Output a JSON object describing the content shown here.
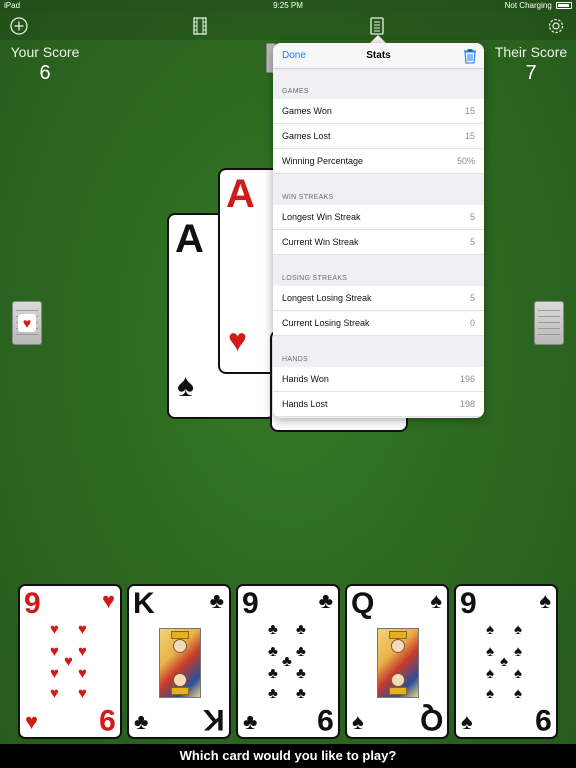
{
  "status_bar": {
    "device": "iPad",
    "time": "9:25 PM",
    "charging": "Not Charging"
  },
  "scores": {
    "you_label": "Your Score",
    "you_value": "6",
    "them_label": "Their Score",
    "them_value": "7"
  },
  "played_cards": [
    {
      "rank": "A",
      "suit": "♠",
      "color": "#111111"
    },
    {
      "rank": "A",
      "suit": "♥",
      "color": "#d21a1a"
    }
  ],
  "stats_popover": {
    "done_label": "Done",
    "title": "Stats",
    "sections": [
      {
        "header": "GAMES",
        "rows": [
          {
            "label": "Games Won",
            "value": "15"
          },
          {
            "label": "Games Lost",
            "value": "15"
          },
          {
            "label": "Winning Percentage",
            "value": "50%"
          }
        ]
      },
      {
        "header": "WIN STREAKS",
        "rows": [
          {
            "label": "Longest Win Streak",
            "value": "5"
          },
          {
            "label": "Current Win Streak",
            "value": "5"
          }
        ]
      },
      {
        "header": "LOSING STREAKS",
        "rows": [
          {
            "label": "Longest Losing Streak",
            "value": "5"
          },
          {
            "label": "Current Losing Streak",
            "value": "0"
          }
        ]
      },
      {
        "header": "HANDS",
        "rows": [
          {
            "label": "Hands Won",
            "value": "196"
          },
          {
            "label": "Hands Lost",
            "value": "198"
          }
        ]
      }
    ]
  },
  "hand": [
    {
      "rank": "9",
      "suit": "♥",
      "color": "#d21a1a"
    },
    {
      "rank": "K",
      "suit": "♣",
      "color": "#111111"
    },
    {
      "rank": "9",
      "suit": "♣",
      "color": "#111111"
    },
    {
      "rank": "Q",
      "suit": "♠",
      "color": "#111111"
    },
    {
      "rank": "9",
      "suit": "♠",
      "color": "#111111"
    }
  ],
  "prompt": "Which card would you like to play?"
}
